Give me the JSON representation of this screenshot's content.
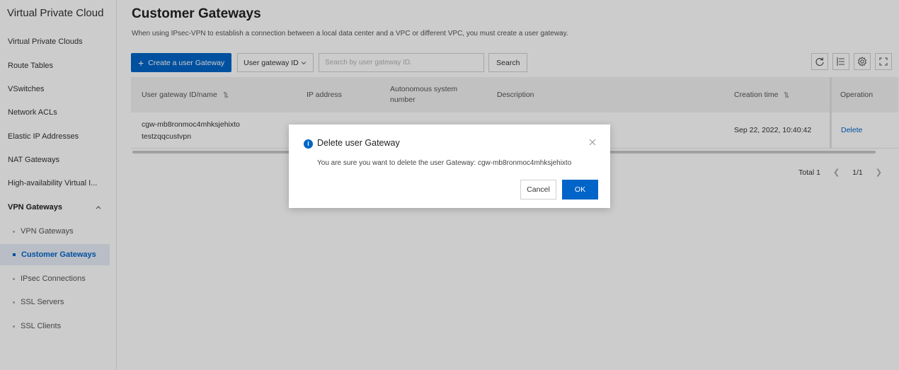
{
  "sidebar": {
    "title": "Virtual Private Cloud",
    "items": [
      {
        "label": "Virtual Private Clouds"
      },
      {
        "label": "Route Tables"
      },
      {
        "label": "VSwitches"
      },
      {
        "label": "Network ACLs"
      },
      {
        "label": "Elastic IP Addresses"
      },
      {
        "label": "NAT Gateways"
      },
      {
        "label": "High-availability Virtual I..."
      },
      {
        "label": "VPN Gateways"
      }
    ],
    "sub_items": [
      {
        "label": "VPN Gateways"
      },
      {
        "label": "Customer Gateways"
      },
      {
        "label": "IPsec Connections"
      },
      {
        "label": "SSL Servers"
      },
      {
        "label": "SSL Clients"
      }
    ]
  },
  "page": {
    "title": "Customer Gateways",
    "description": "When using IPsec-VPN to establish a connection between a local data center and a VPC or different VPC, you must create a user gateway."
  },
  "toolbar": {
    "create_label": "Create a user Gateway",
    "filter_select": "User gateway ID",
    "search_placeholder": "Search by user gateway ID.",
    "search_button": "Search"
  },
  "table": {
    "columns": {
      "id_name": "User gateway ID/name",
      "ip": "IP address",
      "asn": "Autonomous system number",
      "description": "Description",
      "created": "Creation time",
      "operation": "Operation"
    },
    "rows": [
      {
        "id": "cgw-mb8ronmoc4mhksjehixto",
        "name": "testzqqcustvpn",
        "created": "Sep 22, 2022, 10:40:42",
        "action": "Delete"
      }
    ]
  },
  "pagination": {
    "total": "Total 1",
    "pages": "1/1"
  },
  "modal": {
    "title": "Delete user Gateway",
    "message": "You are sure you want to delete the user Gateway: cgw-mb8ronmoc4mhksjehixto",
    "cancel": "Cancel",
    "ok": "OK"
  },
  "colors": {
    "accent": "#0064c8",
    "overlay": "rgba(0,0,0,0.2)"
  }
}
